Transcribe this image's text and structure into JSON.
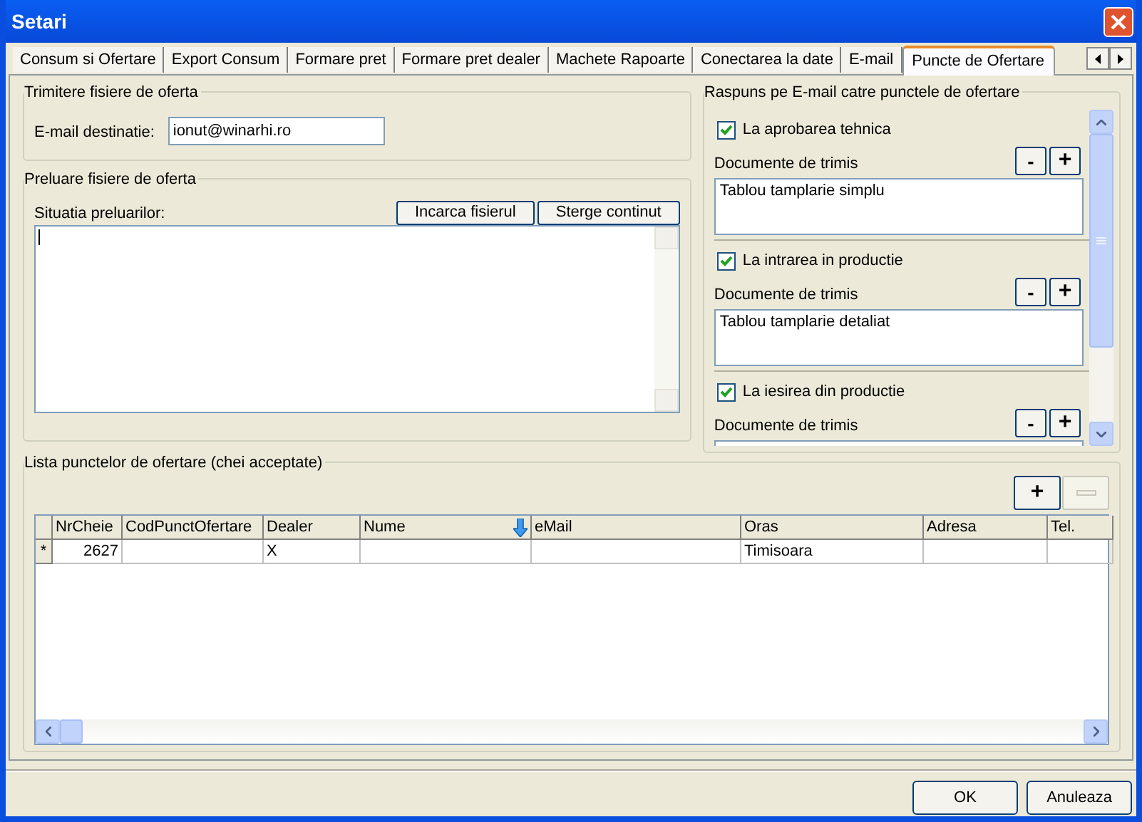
{
  "window": {
    "title": "Setari"
  },
  "tabs": [
    {
      "label": "Consum si Ofertare",
      "selected": false
    },
    {
      "label": "Export Consum",
      "selected": false
    },
    {
      "label": "Formare pret",
      "selected": false
    },
    {
      "label": "Formare pret dealer",
      "selected": false
    },
    {
      "label": "Machete Rapoarte",
      "selected": false
    },
    {
      "label": "Conectarea la date",
      "selected": false
    },
    {
      "label": "E-mail",
      "selected": false
    },
    {
      "label": "Puncte de Ofertare",
      "selected": true
    }
  ],
  "send_group": {
    "title": "Trimitere fisiere de oferta",
    "email_label": "E-mail destinatie:",
    "email_value": "ionut@winarhi.ro"
  },
  "import_group": {
    "title": "Preluare fisiere de oferta",
    "status_label": "Situatia preluarilor:",
    "buttons": [
      "Incarca fisierul",
      "Sterge continut"
    ]
  },
  "reply_group": {
    "title": "Raspuns pe E-mail catre punctele de ofertare",
    "items": [
      {
        "label": "La aprobarea tehnica",
        "checked": true,
        "documents_label": "Documente de trimis",
        "remove_button": "-",
        "add_button": "+",
        "documents": [
          "Tablou tamplarie simplu"
        ]
      },
      {
        "label": "La intrarea in productie",
        "checked": true,
        "documents_label": "Documente de trimis",
        "remove_button": "-",
        "add_button": "+",
        "documents": [
          "Tablou tamplarie detaliat"
        ]
      },
      {
        "label": "La iesirea din productie",
        "checked": true,
        "documents_label": "Documente de trimis",
        "remove_button": "-",
        "add_button": "+"
      }
    ]
  },
  "list_group": {
    "title": "Lista punctelor de ofertare (chei acceptate)",
    "add_button": "+",
    "remove_disabled": true,
    "table": {
      "columns": [
        {
          "label": "NrCheie",
          "sorted": false
        },
        {
          "label": "CodPunctOfertare",
          "sorted": false
        },
        {
          "label": "Dealer",
          "sorted": false
        },
        {
          "label": "Nume",
          "sorted": true
        },
        {
          "label": "eMail",
          "sorted": false
        },
        {
          "label": "Oras",
          "sorted": false
        },
        {
          "label": "Adresa",
          "sorted": false
        },
        {
          "label": "Tel.",
          "sorted": false
        }
      ],
      "rows": [
        {
          "marker": "*",
          "cells": [
            "2627",
            null,
            "X",
            null,
            null,
            "Timisoara",
            null,
            null
          ]
        }
      ]
    }
  },
  "buttons": [
    "OK",
    "Anuleaza"
  ]
}
